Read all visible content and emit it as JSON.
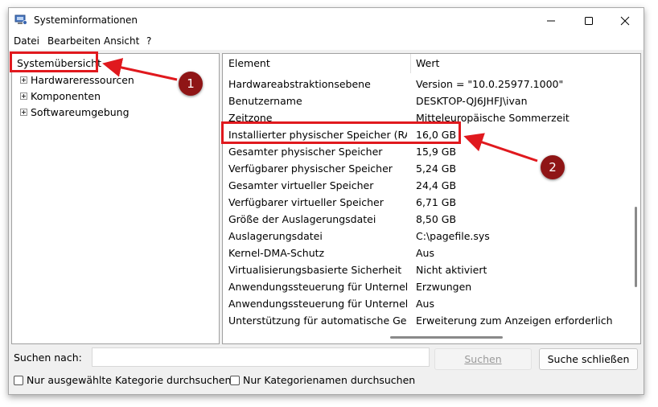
{
  "window": {
    "title": "Systeminformationen",
    "minimize_icon": "minimize-icon",
    "maximize_icon": "maximize-icon",
    "close_icon": "close-icon"
  },
  "menu": [
    "Datei",
    "Bearbeiten",
    "Ansicht",
    "?"
  ],
  "tree": {
    "root": "Systemübersicht",
    "nodes": [
      "Hardwareressourcen",
      "Komponenten",
      "Softwareumgebung"
    ]
  },
  "table": {
    "headers": [
      "Element",
      "Wert"
    ],
    "rows": [
      {
        "name": "Hardwareabstraktionsebene",
        "value": "Version = \"10.0.25977.1000\""
      },
      {
        "name": "Benutzername",
        "value": "DESKTOP-QJ6JHFJ\\ivan"
      },
      {
        "name": "Zeitzone",
        "value": "Mitteleuropäische Sommerzeit"
      },
      {
        "name": "Installierter physischer Speicher (RAM)",
        "value": "16,0 GB"
      },
      {
        "name": "Gesamter physischer Speicher",
        "value": "15,9 GB"
      },
      {
        "name": "Verfügbarer physischer Speicher",
        "value": "5,24 GB"
      },
      {
        "name": "Gesamter virtueller Speicher",
        "value": "24,4 GB"
      },
      {
        "name": "Verfügbarer virtueller Speicher",
        "value": "6,71 GB"
      },
      {
        "name": "Größe der Auslagerungsdatei",
        "value": "8,50 GB"
      },
      {
        "name": "Auslagerungsdatei",
        "value": "C:\\pagefile.sys"
      },
      {
        "name": "Kernel-DMA-Schutz",
        "value": "Aus"
      },
      {
        "name": "Virtualisierungsbasierte Sicherheit",
        "value": "Nicht aktiviert"
      },
      {
        "name": "Anwendungssteuerung für Unterneh...",
        "value": "Erzwungen"
      },
      {
        "name": "Anwendungssteuerung für Unterneh...",
        "value": "Aus"
      },
      {
        "name": "Unterstützung für automatische Gerä...",
        "value": "Erweiterung zum Anzeigen erforderlich"
      }
    ]
  },
  "search": {
    "label": "Suchen nach:",
    "value": "",
    "search_button": "Suchen",
    "close_button": "Suche schließen",
    "only_selected_category": "Nur ausgewählte Kategorie durchsuchen",
    "only_category_names": "Nur Kategorienamen durchsuchen"
  },
  "annotations": {
    "marker_1": "1",
    "marker_2": "2",
    "highlight_color": "#e0191e",
    "marker_color": "#8f1516"
  }
}
